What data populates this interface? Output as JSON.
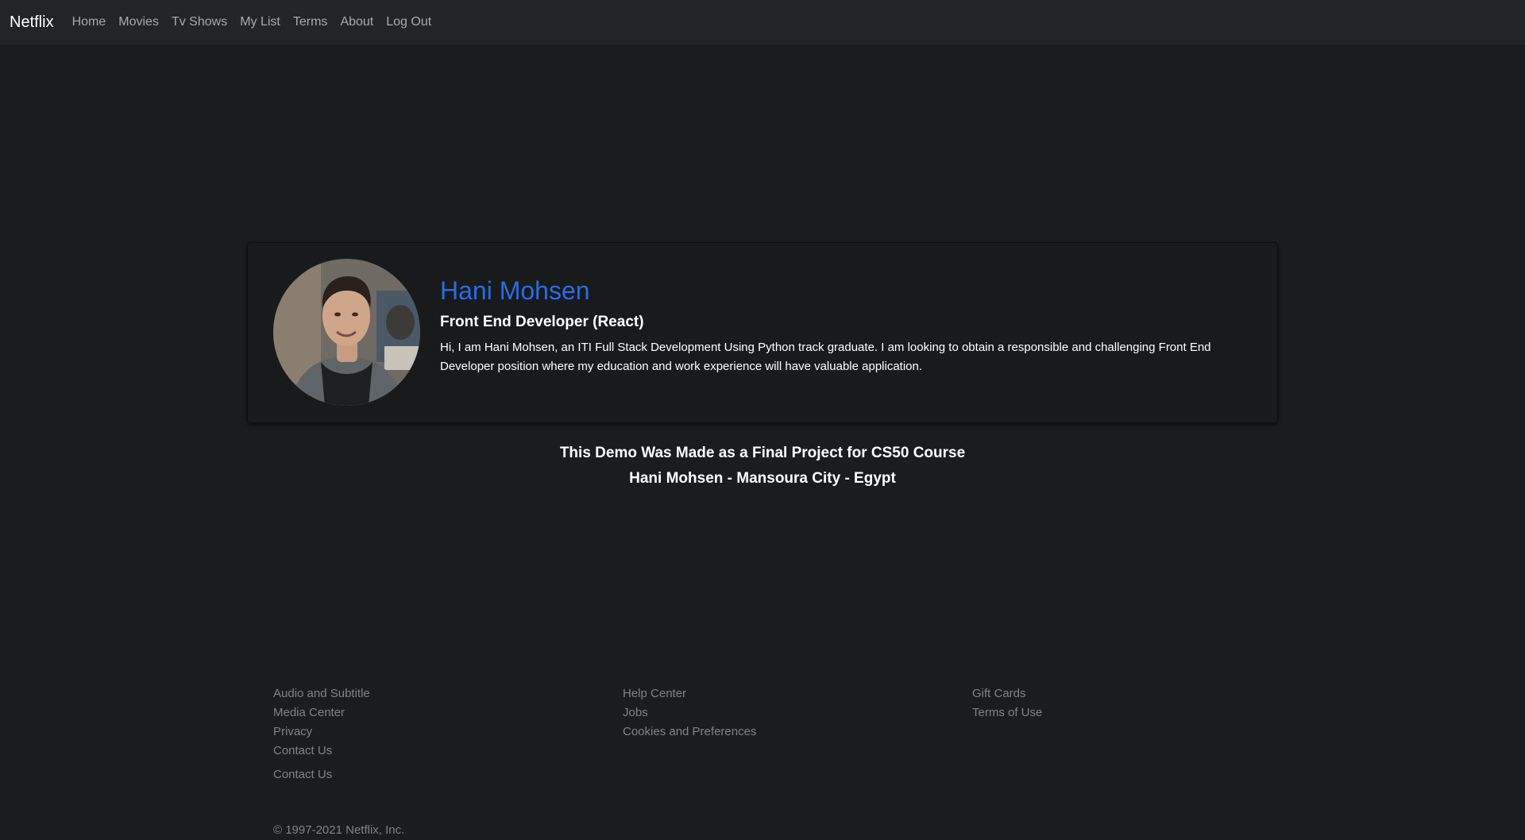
{
  "navbar": {
    "brand": "Netflix",
    "links": [
      "Home",
      "Movies",
      "Tv Shows",
      "My List",
      "Terms",
      "About",
      "Log Out"
    ]
  },
  "profile": {
    "name": "Hani Mohsen",
    "role": "Front End Developer (React)",
    "bio": "Hi, I am Hani Mohsen, an ITI Full Stack Development Using Python track graduate. I am looking to obtain a responsible and challenging Front End Developer position where my education and work experience will have valuable application.",
    "name_color": "#2a6be6"
  },
  "credits": {
    "line1": "This Demo Was Made as a Final Project for CS50 Course",
    "line2": "Hani Mohsen - Mansoura City - Egypt"
  },
  "footer": {
    "col1": [
      "Audio and Subtitle",
      "Media Center",
      "Privacy",
      "Contact Us"
    ],
    "col2": [
      "Help Center",
      "Jobs",
      "Cookies and Preferences"
    ],
    "col3": [
      "Gift Cards",
      "Terms of Use"
    ],
    "extra": "Contact Us",
    "copyright": "© 1997-2021 Netflix, Inc."
  }
}
